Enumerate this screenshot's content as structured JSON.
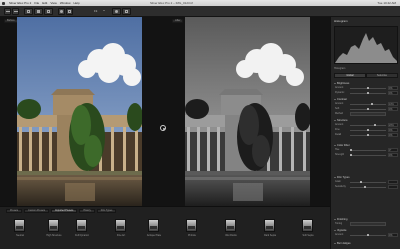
{
  "menubar": {
    "app_menus": [
      "Silver Efex Pro 2",
      "File",
      "Edit",
      "View",
      "Window",
      "Help"
    ],
    "window_title": "Silver Efex Pro 2 – IMG_0123.tif",
    "clock": "Tue 10:42 AM"
  },
  "toolbar": {
    "zoom": "Fit"
  },
  "viewer": {
    "before_label": "Before",
    "after_label": "After"
  },
  "right_panel": {
    "header": "Histogram",
    "histogram_caption": "Histogram",
    "tabs": [
      "Global",
      "Selective"
    ],
    "sections": [
      {
        "name": "Brightness",
        "rows": [
          {
            "label": "Amount",
            "value": "0%"
          },
          {
            "label": "Dynamic",
            "value": "0%"
          }
        ]
      },
      {
        "name": "Contrast",
        "rows": [
          {
            "label": "Amount",
            "value": "10%"
          },
          {
            "label": "Soft",
            "value": "0%"
          },
          {
            "label": "Method",
            "value": ""
          }
        ]
      },
      {
        "name": "Structure",
        "rows": [
          {
            "label": "Amount",
            "value": "20%"
          },
          {
            "label": "Fine",
            "value": "0%"
          },
          {
            "label": "Detail",
            "value": "0%"
          }
        ]
      },
      {
        "name": "Color Filter",
        "rows": [
          {
            "label": "Hue",
            "value": "0°"
          },
          {
            "label": "Strength",
            "value": "0%"
          }
        ]
      },
      {
        "name": "Film Types",
        "rows": [
          {
            "label": "Grain",
            "value": ""
          },
          {
            "label": "Sensitivity",
            "value": ""
          }
        ]
      },
      {
        "name": "Finishing",
        "rows": [
          {
            "label": "Toning",
            "value": ""
          }
        ]
      },
      {
        "name": "Vignette",
        "rows": [
          {
            "label": "Amount",
            "value": "0%"
          }
        ]
      }
    ],
    "footer": "Burn Edges"
  },
  "filmstrip": {
    "tabs": [
      "Presets",
      "Custom Presets",
      "Imported Presets",
      "History",
      "Film Types"
    ],
    "active_tab": 2,
    "thumbs": [
      "Neutral",
      "High Structure",
      "Full Dynamic",
      "Fine Art",
      "Antique Plate",
      "Pinhole",
      "Wet Rocks",
      "Dark Sepia",
      "Soft Sepia"
    ]
  },
  "colors": {
    "panel_bg": "#262626",
    "viewer_bg": "#131313",
    "sky_blue": "#6f8fc1",
    "foliage_green": "#2a4a1d",
    "architecture_tan": "#b49a74"
  },
  "icons": {
    "undo": "undo-arrow-icon",
    "redo": "redo-arrow-icon",
    "compare": "split-view-icon",
    "hand": "hand-tool-icon",
    "zoom": "magnifier-icon",
    "divider": "divider-toggle-icon"
  }
}
